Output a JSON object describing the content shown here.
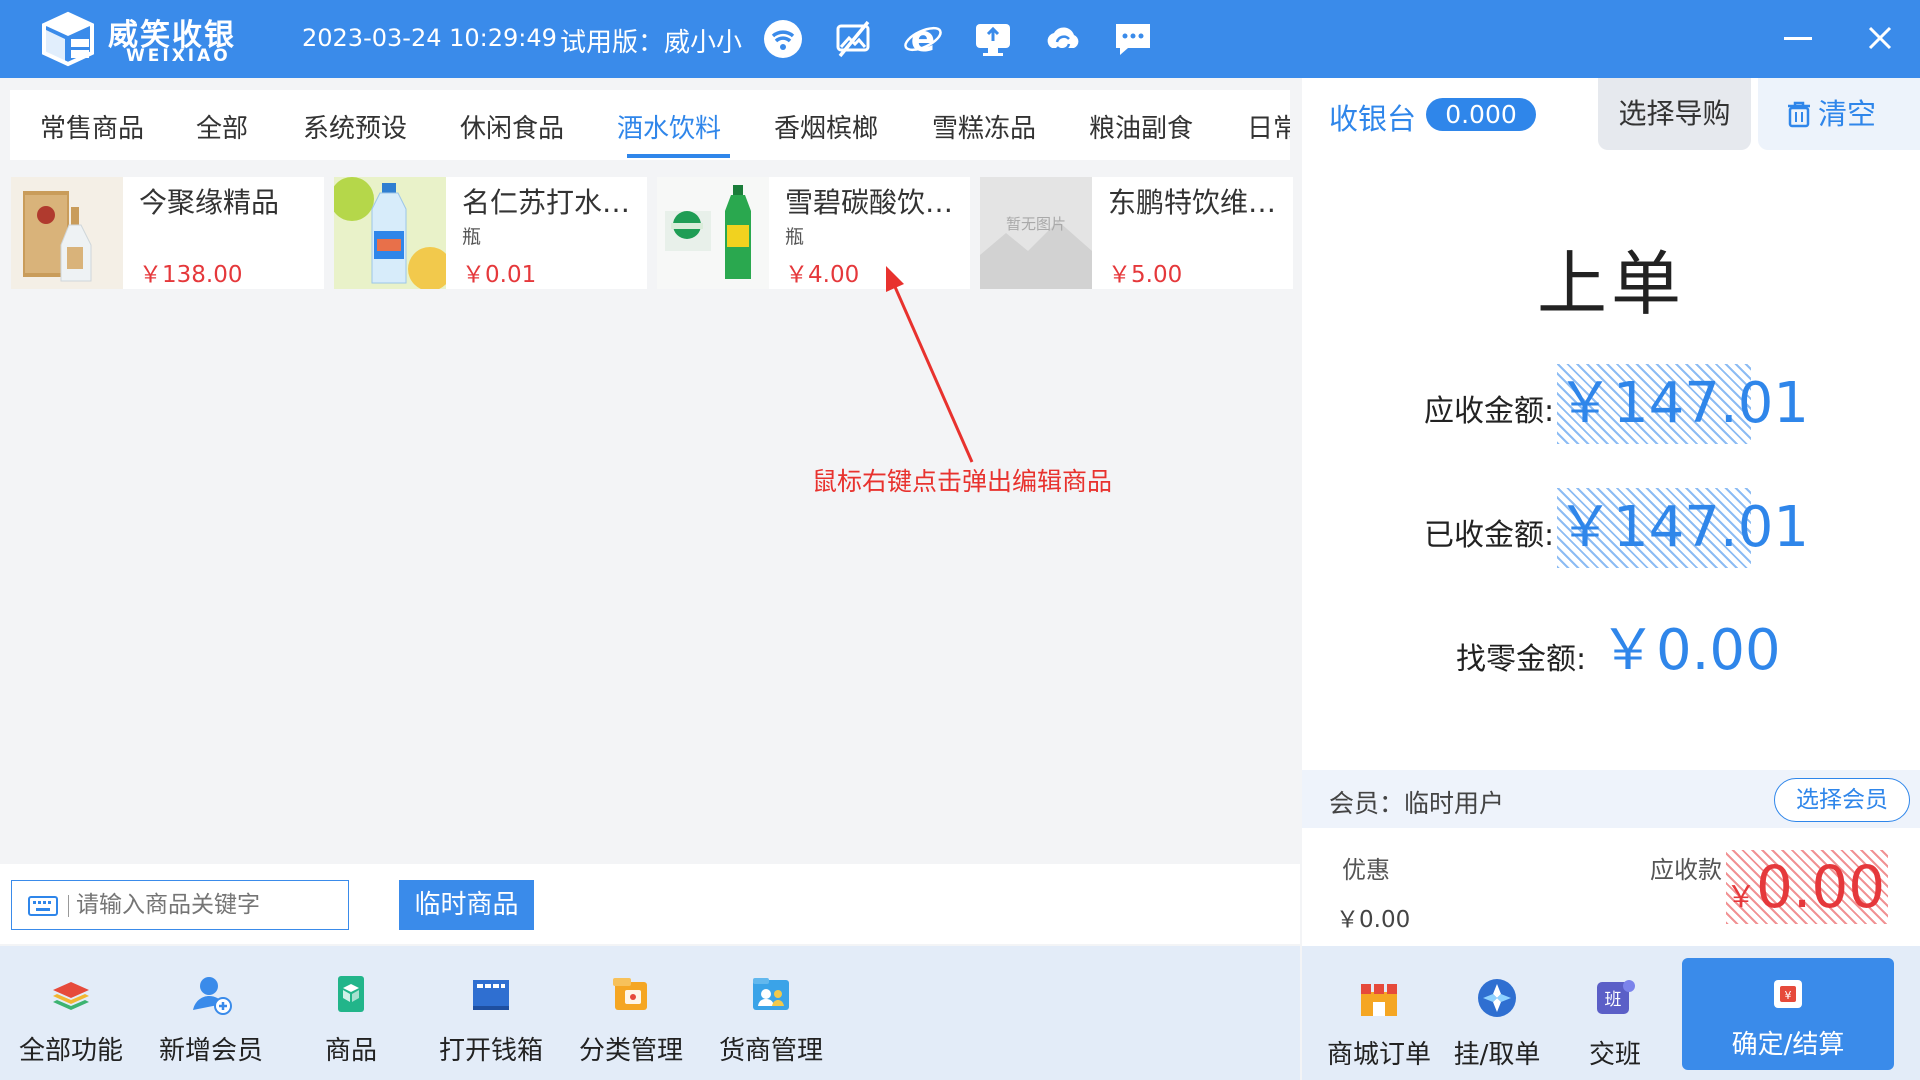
{
  "app": {
    "brand_cn": "威笑收银",
    "brand_en": "WEIXIAO",
    "datetime": "2023-03-24 10:29:49",
    "trial": "试用版：威小小",
    "icons": [
      "wifi-icon",
      "image-off-icon",
      "ie-browser-icon",
      "monitor-upload-icon",
      "cloud-sync-icon",
      "chat-icon"
    ]
  },
  "tabs": [
    {
      "label": "常售商品"
    },
    {
      "label": "全部"
    },
    {
      "label": "系统预设"
    },
    {
      "label": "休闲食品"
    },
    {
      "label": "酒水饮料"
    },
    {
      "label": "香烟槟榔"
    },
    {
      "label": "雪糕冻品"
    },
    {
      "label": "粮油副食"
    },
    {
      "label": "日常"
    }
  ],
  "active_tab": "酒水饮料",
  "products": [
    {
      "name": "今聚缘精品",
      "unit": "",
      "price": "￥138.00",
      "image": "liquor-bottle-box"
    },
    {
      "name": "名仁苏打水…",
      "unit": "瓶",
      "price": "￥0.01",
      "image": "soda-water-bottle"
    },
    {
      "name": "雪碧碳酸饮…",
      "unit": "瓶",
      "price": "￥4.00",
      "image": "sprite-bottle"
    },
    {
      "name": "东鹏特饮维…",
      "unit": "",
      "price": "￥5.00",
      "image": "placeholder-image"
    }
  ],
  "placeholder_image_text": "暂无图片",
  "annotation": "鼠标右键点击弹出编辑商品",
  "search": {
    "placeholder": "请输入商品关键字"
  },
  "temp_goods_label": "临时商品",
  "tools": [
    {
      "label": "全部功能",
      "icon": "layers-icon"
    },
    {
      "label": "新增会员",
      "icon": "add-member-icon"
    },
    {
      "label": "商品",
      "icon": "product-icon"
    },
    {
      "label": "打开钱箱",
      "icon": "cash-drawer-icon"
    },
    {
      "label": "分类管理",
      "icon": "category-icon"
    },
    {
      "label": "货商管理",
      "icon": "supplier-icon"
    }
  ],
  "cashier": {
    "title": "收银台",
    "badge": "0.000",
    "guide_label": "选择导购",
    "clear_label": "清空",
    "order_title": "上单",
    "due_label": "应收金额:",
    "due_value": "￥147.01",
    "paid_label": "已收金额:",
    "paid_value": "￥147.01",
    "change_label": "找零金额:",
    "change_value": "￥0.00",
    "member_text": "会员：临时用户",
    "member_btn": "选择会员",
    "discount_label": "优惠",
    "discount_value": "￥0.00",
    "receivable_label": "应收款",
    "receivable_yen": "￥",
    "receivable_value": "0.00"
  },
  "right_tools": [
    {
      "label": "商城订单",
      "icon": "mall-order-icon"
    },
    {
      "label": "挂/取单",
      "icon": "hang-order-icon"
    },
    {
      "label": "交班",
      "icon": "shift-handover-icon"
    }
  ],
  "confirm_label": "确定/结算",
  "colors": {
    "primary": "#3a8bea",
    "accent_blue": "#2f86ea",
    "price_red": "#e5383b",
    "annotation_red": "#e8322e"
  }
}
